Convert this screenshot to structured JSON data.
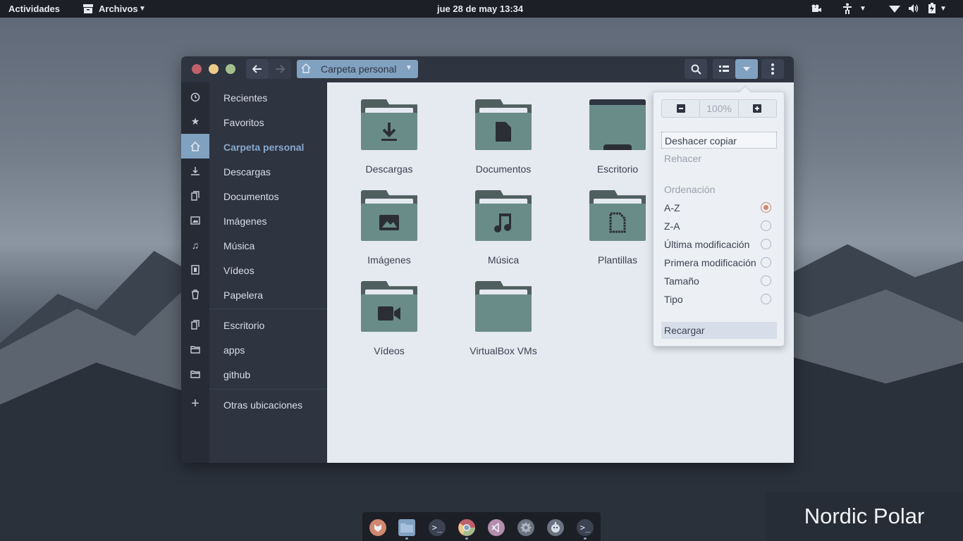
{
  "topbar": {
    "activities": "Actividades",
    "app_menu": "Archivos",
    "clock": "jue 28 de may  13:34"
  },
  "window": {
    "path_label": "Carpeta personal"
  },
  "sidebar": {
    "items": [
      {
        "label": "Recientes",
        "icon": "clock-icon"
      },
      {
        "label": "Favoritos",
        "icon": "star-icon"
      },
      {
        "label": "Carpeta personal",
        "icon": "home-icon",
        "active": true
      },
      {
        "label": "Descargas",
        "icon": "download-icon"
      },
      {
        "label": "Documentos",
        "icon": "document-icon"
      },
      {
        "label": "Imágenes",
        "icon": "image-icon"
      },
      {
        "label": "Música",
        "icon": "music-icon"
      },
      {
        "label": "Vídeos",
        "icon": "video-icon"
      },
      {
        "label": "Papelera",
        "icon": "trash-icon"
      }
    ],
    "bookmarks": [
      {
        "label": "Escritorio",
        "icon": "document-icon"
      },
      {
        "label": "apps",
        "icon": "folder-icon"
      },
      {
        "label": "github",
        "icon": "folder-icon"
      }
    ],
    "other": {
      "label": "Otras ubicaciones",
      "icon": "plus-icon"
    }
  },
  "files": [
    {
      "name": "Descargas",
      "glyph": "download"
    },
    {
      "name": "Documentos",
      "glyph": "document"
    },
    {
      "name": "Escritorio",
      "glyph": "desktop"
    },
    {
      "name": "Imágenes",
      "glyph": "image"
    },
    {
      "name": "Música",
      "glyph": "music"
    },
    {
      "name": "Plantillas",
      "glyph": "template"
    },
    {
      "name": "Vídeos",
      "glyph": "video"
    },
    {
      "name": "VirtualBox VMs",
      "glyph": "none"
    }
  ],
  "popover": {
    "zoom_value": "100%",
    "undo": "Deshacer copiar",
    "redo": "Rehacer",
    "sort_heading": "Ordenación",
    "sort_options": [
      {
        "label": "A-Z",
        "selected": true
      },
      {
        "label": "Z-A",
        "selected": false
      },
      {
        "label": "Última modificación",
        "selected": false
      },
      {
        "label": "Primera modificación",
        "selected": false
      },
      {
        "label": "Tamaño",
        "selected": false
      },
      {
        "label": "Tipo",
        "selected": false
      }
    ],
    "reload": "Recargar"
  },
  "dock": {
    "apps": [
      "firefox-icon",
      "files-icon",
      "terminal-icon",
      "chrome-icon",
      "vscode-icon",
      "settings-icon",
      "gimp-icon",
      "terminal-icon"
    ]
  },
  "watermark": "Nordic Polar",
  "colors": {
    "accent": "#81a1c1",
    "close": "#bf616a",
    "minimize": "#ebcb8b",
    "maximize": "#a3be8c",
    "folder": "#6a8c88",
    "radio_selected": "#d08770"
  }
}
